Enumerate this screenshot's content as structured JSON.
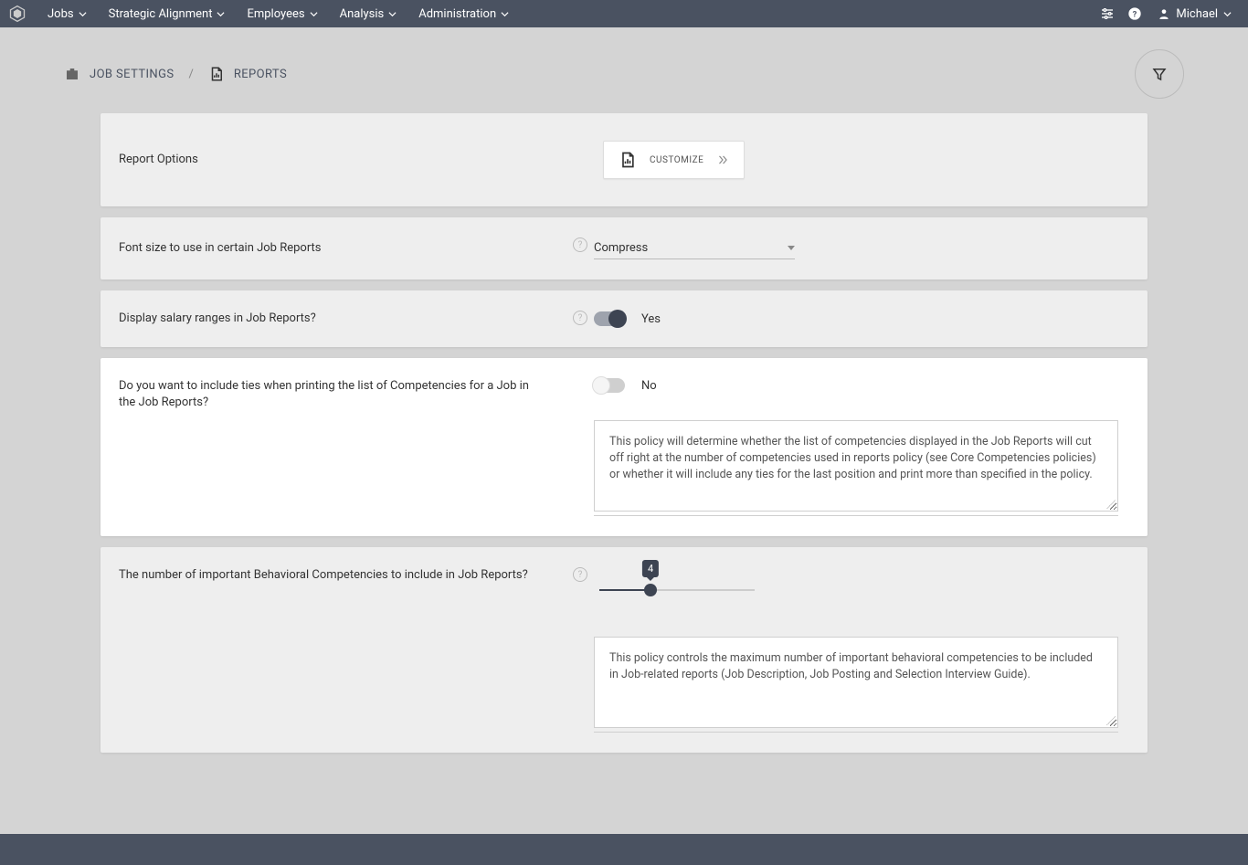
{
  "nav": {
    "items": [
      "Jobs",
      "Strategic Alignment",
      "Employees",
      "Analysis",
      "Administration"
    ]
  },
  "user": {
    "name": "Michael"
  },
  "breadcrumb": {
    "item1": "JOB SETTINGS",
    "item2": "REPORTS"
  },
  "cards": {
    "reportOptions": {
      "label": "Report Options",
      "button": "CUSTOMIZE"
    },
    "fontSize": {
      "label": "Font size to use in certain Job Reports",
      "value": "Compress"
    },
    "displaySalary": {
      "label": "Display salary ranges in Job Reports?",
      "value": "Yes",
      "on": true
    },
    "includeTies": {
      "label": "Do you want to include ties when printing the list of Competencies for a Job in the Job Reports?",
      "value": "No",
      "on": false,
      "desc": "This policy will determine whether the list of competencies displayed in the Job Reports will cut off right at the number of competencies used in reports policy (see Core Competencies policies) or whether it will include any ties for the last position and print more than specified in the policy."
    },
    "behavioralCount": {
      "label": "The number of important Behavioral Competencies to include in Job Reports?",
      "value": "4",
      "percent": 33,
      "desc": "This policy controls the maximum number of important behavioral competencies to be included in Job-related reports (Job Description, Job Posting and Selection Interview Guide)."
    }
  }
}
